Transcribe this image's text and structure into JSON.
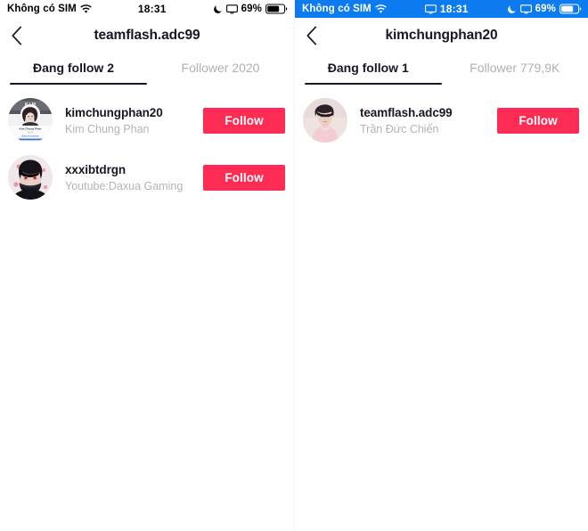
{
  "colors": {
    "accent": "#FE2C55",
    "recording_bar": "#0B7BEF",
    "text_primary": "#161823",
    "text_muted": "#B3B3B8",
    "indicator": "#161823"
  },
  "screens": [
    {
      "id": "left",
      "status_bar": {
        "recording": false,
        "carrier": "Không có SIM",
        "wifi_icon": "wifi-icon",
        "time": "18:31",
        "dnd_icon": "moon-icon",
        "screen_mirror_icon": "screen-mirroring-icon",
        "battery_percent": "69%",
        "battery_icon": "battery-icon"
      },
      "nav": {
        "back_icon": "chevron-left-icon",
        "title": "teamflash.adc99"
      },
      "tabs": [
        {
          "label": "Đang follow 2",
          "active": true
        },
        {
          "label": "Follower 2020",
          "active": false
        }
      ],
      "users": [
        {
          "avatar": "avatar-kimchungphan20",
          "name": "kimchungphan20",
          "subtitle": "Kim Chung Phan",
          "action_label": "Follow"
        },
        {
          "avatar": "avatar-xxxibtdrgn",
          "name": "xxxibtdrgn",
          "subtitle": "Youtube:Daxua Gaming",
          "action_label": "Follow"
        }
      ]
    },
    {
      "id": "right",
      "status_bar": {
        "recording": true,
        "carrier": "Không có SIM",
        "wifi_icon": "wifi-icon",
        "time": "18:31",
        "dnd_icon": "moon-icon",
        "screen_mirror_icon": "screen-mirroring-icon",
        "battery_percent": "69%",
        "battery_icon": "battery-icon"
      },
      "nav": {
        "back_icon": "chevron-left-icon",
        "title": "kimchungphan20"
      },
      "tabs": [
        {
          "label": "Đang follow 1",
          "active": true
        },
        {
          "label": "Follower 779,9K",
          "active": false
        }
      ],
      "users": [
        {
          "avatar": "avatar-teamflash-adc99",
          "name": "teamflash.adc99",
          "subtitle": "Trần Đức Chiến",
          "action_label": "Follow"
        }
      ]
    }
  ]
}
